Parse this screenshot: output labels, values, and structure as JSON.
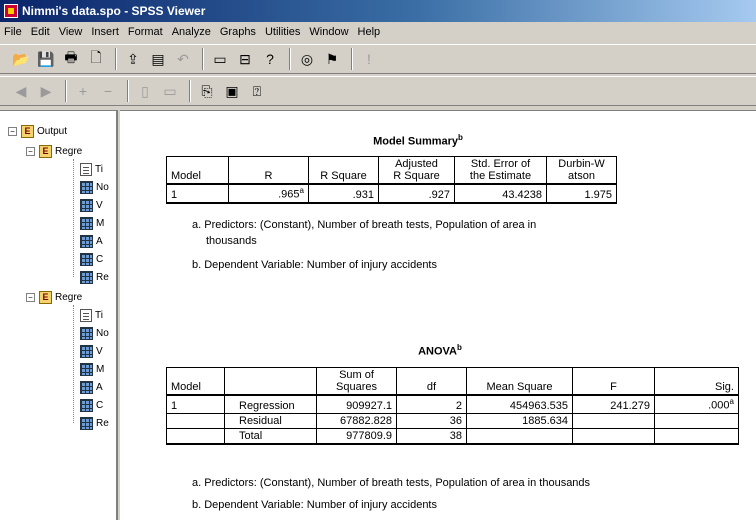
{
  "window": {
    "title": "Nimmi's data.spo - SPSS Viewer"
  },
  "menu": [
    "File",
    "Edit",
    "View",
    "Insert",
    "Format",
    "Analyze",
    "Graphs",
    "Utilities",
    "Window",
    "Help"
  ],
  "toolbar1": [
    {
      "icon": "open-icon",
      "glyph": "📂",
      "disabled": false
    },
    {
      "icon": "save-icon",
      "glyph": "💾",
      "disabled": false
    },
    {
      "icon": "print-icon",
      "glyph": "🖶",
      "disabled": false
    },
    {
      "icon": "print-preview-icon",
      "glyph": "🗋",
      "disabled": false
    },
    {
      "icon": "export-icon",
      "glyph": "⇪",
      "disabled": false
    },
    {
      "icon": "dialog-recall-icon",
      "glyph": "▤",
      "disabled": false
    },
    {
      "icon": "undo-icon",
      "glyph": "↶",
      "disabled": true
    },
    {
      "icon": "goto-data-icon",
      "glyph": "▭",
      "disabled": false
    },
    {
      "icon": "goto-case-icon",
      "glyph": "⊟",
      "disabled": false
    },
    {
      "icon": "variables-icon",
      "glyph": "?",
      "disabled": false
    },
    {
      "icon": "use-sets-icon",
      "glyph": "◎",
      "disabled": false
    },
    {
      "icon": "designate-window-icon",
      "glyph": "⚑",
      "disabled": false
    },
    {
      "icon": "run-icon",
      "glyph": "!",
      "disabled": true
    }
  ],
  "toolbar2": [
    {
      "icon": "promote-icon",
      "glyph": "◀",
      "disabled": true
    },
    {
      "icon": "demote-icon",
      "glyph": "▶",
      "disabled": true
    },
    {
      "icon": "collapse-icon",
      "glyph": "+",
      "disabled": true
    },
    {
      "icon": "expand-icon",
      "glyph": "−",
      "disabled": true
    },
    {
      "icon": "show-icon",
      "glyph": "▯",
      "disabled": true
    },
    {
      "icon": "hide-icon",
      "glyph": "▭",
      "disabled": true
    },
    {
      "icon": "insert-heading-icon",
      "glyph": "⎘",
      "disabled": false
    },
    {
      "icon": "insert-title-icon",
      "glyph": "▣",
      "disabled": false
    },
    {
      "icon": "insert-text-icon",
      "glyph": "⍰",
      "disabled": false
    }
  ],
  "outline": {
    "root": "Output",
    "groups": [
      {
        "label": "Regre",
        "items": [
          "Ti",
          "No",
          "V",
          "M",
          "A",
          "C",
          "Re"
        ]
      },
      {
        "label": "Regre",
        "items": [
          "Ti",
          "No",
          "V",
          "M",
          "A",
          "C",
          "Re"
        ]
      }
    ]
  },
  "model_summary": {
    "title": "Model Summary",
    "title_sup": "b",
    "headers": [
      "Model",
      "R",
      "R Square",
      "Adjusted",
      "R Square",
      "Std. Error of",
      "the Estimate",
      "Durbin-W",
      "atson"
    ],
    "row": {
      "model": "1",
      "r": ".965",
      "r_sup": "a",
      "r_square": ".931",
      "adj_r_square": ".927",
      "std_err": "43.4238",
      "durbin_watson": "1.975"
    },
    "footnote_a1": "a. Predictors: (Constant), Number of breath tests, Population of area in",
    "footnote_a2": "thousands",
    "footnote_b": "b. Dependent Variable: Number of injury accidents"
  },
  "anova": {
    "title": "ANOVA",
    "title_sup": "b",
    "headers": {
      "model": "Model",
      "ss1": "Sum of",
      "ss2": "Squares",
      "df": "df",
      "ms": "Mean Square",
      "f": "F",
      "sig": "Sig."
    },
    "model": "1",
    "rows": [
      {
        "label": "Regression",
        "ss": "909927.1",
        "df": "2",
        "ms": "454963.535",
        "f": "241.279",
        "sig": ".000",
        "sig_sup": "a"
      },
      {
        "label": "Residual",
        "ss": "67882.828",
        "df": "36",
        "ms": "1885.634",
        "f": "",
        "sig": "",
        "sig_sup": ""
      },
      {
        "label": "Total",
        "ss": "977809.9",
        "df": "38",
        "ms": "",
        "f": "",
        "sig": "",
        "sig_sup": ""
      }
    ],
    "footnote_a": "a. Predictors: (Constant), Number of breath tests, Population of area in thousands",
    "footnote_b": "b. Dependent Variable: Number of injury accidents"
  }
}
